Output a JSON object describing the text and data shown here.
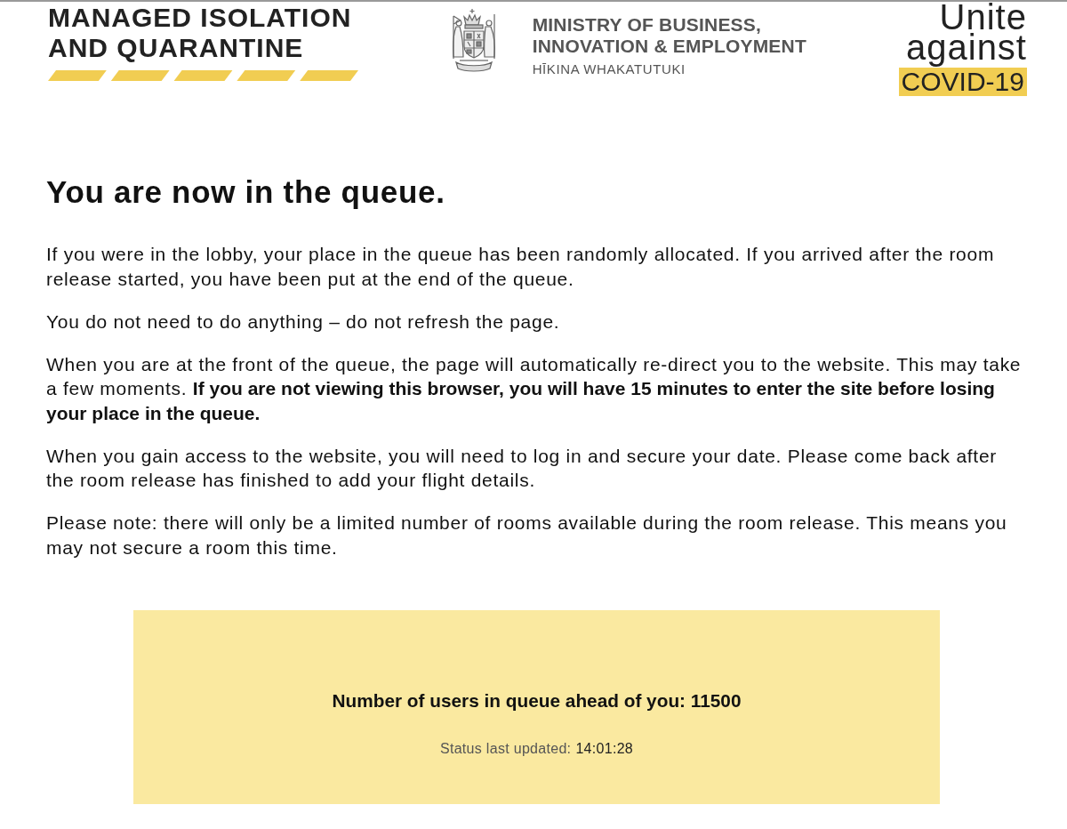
{
  "header": {
    "program_logo": {
      "lines": [
        "MANAGED ISOLATION",
        "AND QUARANTINE"
      ]
    },
    "ministry_logo": {
      "name_lines": [
        "MINISTRY OF BUSINESS,",
        "INNOVATION & EMPLOYMENT"
      ],
      "maori_name": "HĪKINA WHAKATUTUKI"
    },
    "campaign_logo": {
      "lines": [
        "Unite",
        "against"
      ],
      "highlight": "COVID-19"
    }
  },
  "main": {
    "heading": "You are now in the queue.",
    "paragraphs": [
      "If you were in the lobby, your place in the queue has been randomly allocated. If you arrived after the room release started, you have been put at the end of the queue.",
      "You do not need to do anything – do not refresh the page.",
      "When you are at the front of the queue, the page will automatically re-direct you to the website. This may take a few moments. **If you are not viewing this browser, you will have 15 minutes to enter the site before losing your place in the queue.**",
      "When you gain access to the website, you will need to log in and secure your date. Please come back after the room release has finished to add your flight details.",
      "Please note: there will only be a limited number of rooms available during the room release. This means you may not secure a room this time."
    ]
  },
  "queue_status": {
    "count_text": "Number of users in queue ahead of you: 11500",
    "updated_label": "Status last updated:",
    "updated_time": "14:01:28"
  }
}
